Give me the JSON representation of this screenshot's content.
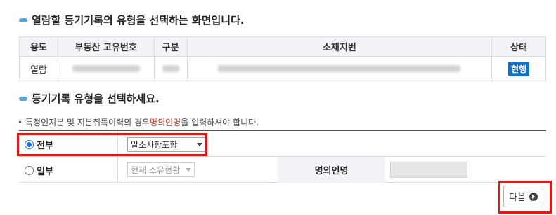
{
  "heading1": "열람할 등기기록의 유형을 선택하는 화면입니다.",
  "table": {
    "headers": [
      "용도",
      "부동산 고유번호",
      "구분",
      "소재지번",
      "상태"
    ],
    "row": {
      "usage": "열람",
      "status_badge": "현행"
    }
  },
  "heading2": "등기기록 유형을 선택하세요.",
  "notice": {
    "prefix": "특정인지분 및 지분취득이력의 경우 ",
    "highlight": "명의인명",
    "suffix": "을 입력하셔야 합니다."
  },
  "options": {
    "full": {
      "label": "전부",
      "checked": true,
      "select_value": "말소사항포함"
    },
    "partial": {
      "label": "일부",
      "checked": false,
      "select_value": "현재 소유현황",
      "name_label": "명의인명",
      "name_value": ""
    }
  },
  "next_button": {
    "label": "다음"
  },
  "colors": {
    "accent": "#1b6fbf",
    "highlight_box": "#e01818",
    "notice_red": "#c0392b",
    "bullet": "#58a6d6"
  }
}
